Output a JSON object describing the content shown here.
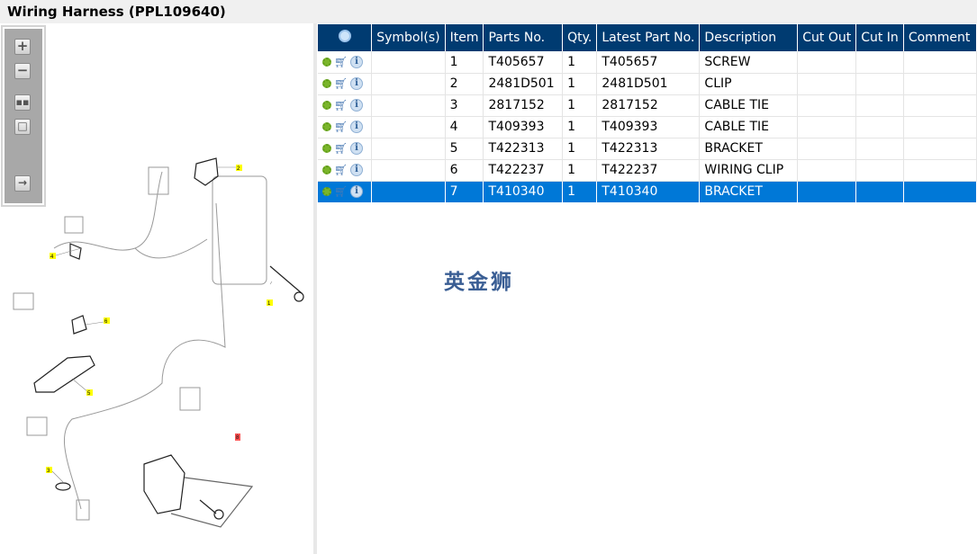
{
  "window": {
    "title": "Wiring Harness (PPL109640)"
  },
  "toolbar": {
    "buttons": [
      "zoom-in",
      "zoom-out",
      "fit-all",
      "actual-size",
      "show-list"
    ]
  },
  "diagram": {
    "callouts": [
      "1",
      "2",
      "3",
      "4",
      "5",
      "6",
      "8"
    ]
  },
  "table": {
    "headers": [
      "Symbol(s)",
      "Item",
      "Parts No.",
      "Qty.",
      "Latest Part No.",
      "Description",
      "Cut Out",
      "Cut In",
      "Comment"
    ],
    "rows": [
      {
        "item": "1",
        "part": "T405657",
        "qty": "1",
        "latest": "T405657",
        "desc": "SCREW"
      },
      {
        "item": "2",
        "part": "2481D501",
        "qty": "1",
        "latest": "2481D501",
        "desc": "CLIP"
      },
      {
        "item": "3",
        "part": "2817152",
        "qty": "1",
        "latest": "2817152",
        "desc": "CABLE TIE"
      },
      {
        "item": "4",
        "part": "T409393",
        "qty": "1",
        "latest": "T409393",
        "desc": "CABLE TIE"
      },
      {
        "item": "5",
        "part": "T422313",
        "qty": "1",
        "latest": "T422313",
        "desc": "BRACKET"
      },
      {
        "item": "6",
        "part": "T422237",
        "qty": "1",
        "latest": "T422237",
        "desc": "WIRING CLIP"
      },
      {
        "item": "7",
        "part": "T410340",
        "qty": "1",
        "latest": "T410340",
        "desc": "BRACKET"
      }
    ],
    "selected_item": "7"
  },
  "watermark": "英金狮",
  "colors": {
    "header": "#003b71",
    "selected": "#0078d7"
  }
}
